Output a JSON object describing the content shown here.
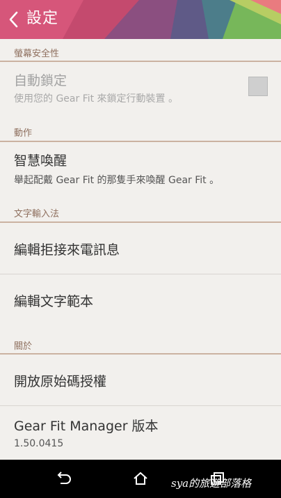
{
  "header": {
    "title": "設定",
    "background_colors": [
      "#d85d7e",
      "#5e5a86",
      "#7ac3c7",
      "#6fae59",
      "#e88d8f"
    ]
  },
  "sections": {
    "security": {
      "title": "螢幕安全性",
      "auto_lock": {
        "title": "自動鎖定",
        "subtitle": "使用您的 Gear Fit 來鎖定行動裝置 。",
        "checked": false,
        "enabled": false
      }
    },
    "actions": {
      "title": "動作",
      "smart_wakeup": {
        "title": "智慧喚醒",
        "subtitle": "舉起配戴 Gear Fit 的那隻手來喚醒 Gear Fit 。"
      }
    },
    "input": {
      "title": "文字輸入法",
      "items": [
        {
          "label": "編輯拒接來電訊息"
        },
        {
          "label": "編輯文字範本"
        }
      ]
    },
    "about": {
      "title": "關於",
      "open_source": "開放原始碼授權",
      "version_title": "Gear Fit Manager 版本",
      "version_value": "1.50.0415"
    }
  },
  "navbar": {
    "back_icon": "back-icon",
    "home_icon": "home-icon",
    "recents_icon": "recents-icon",
    "watermark": "sya的旅遊部落格"
  }
}
